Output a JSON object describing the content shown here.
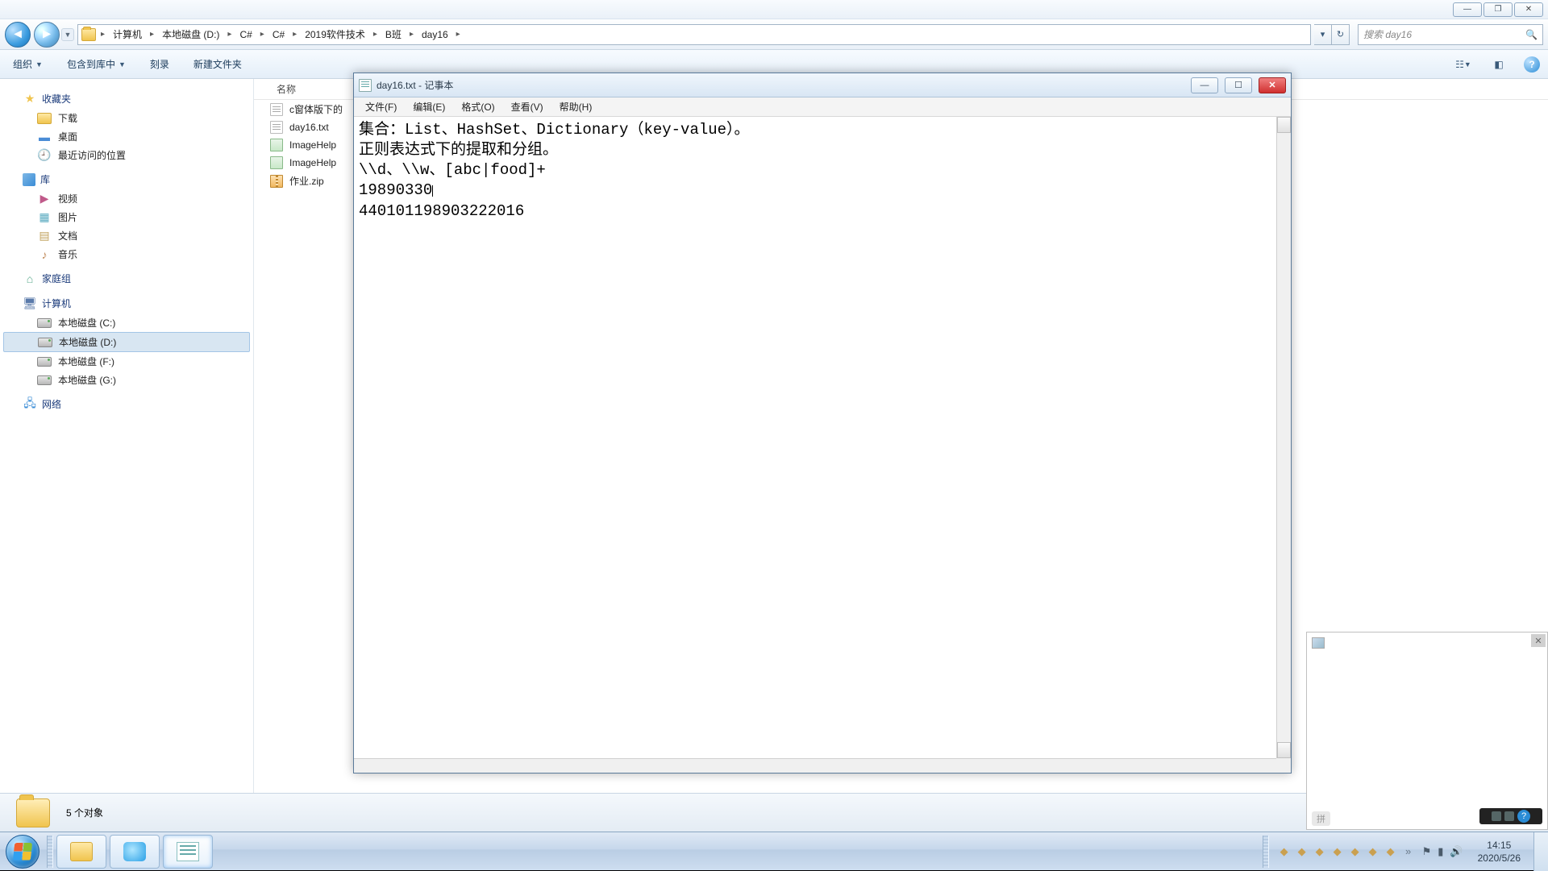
{
  "explorer": {
    "breadcrumbs": [
      "计算机",
      "本地磁盘 (D:)",
      "C#",
      "C#",
      "2019软件技术",
      "B班",
      "day16"
    ],
    "search_placeholder": "搜索 day16",
    "toolbar": {
      "organize": "组织",
      "include": "包含到库中",
      "burn": "刻录",
      "newfolder": "新建文件夹"
    },
    "sidebar": {
      "favorites": {
        "label": "收藏夹",
        "items": [
          "下载",
          "桌面",
          "最近访问的位置"
        ]
      },
      "libraries": {
        "label": "库",
        "items": [
          "视频",
          "图片",
          "文档",
          "音乐"
        ]
      },
      "homegroup": {
        "label": "家庭组"
      },
      "computer": {
        "label": "计算机",
        "items": [
          "本地磁盘 (C:)",
          "本地磁盘 (D:)",
          "本地磁盘 (F:)",
          "本地磁盘 (G:)"
        ]
      },
      "network": {
        "label": "网络"
      }
    },
    "filelist": {
      "header": "名称",
      "items": [
        {
          "name": "c窗体版下的",
          "type": "txt"
        },
        {
          "name": "day16.txt",
          "type": "txt"
        },
        {
          "name": "ImageHelp",
          "type": "cs"
        },
        {
          "name": "ImageHelp",
          "type": "cs"
        },
        {
          "name": "作业.zip",
          "type": "zip"
        }
      ]
    },
    "status": "5 个对象"
  },
  "notepad": {
    "title": "day16.txt - 记事本",
    "menu": [
      "文件(F)",
      "编辑(E)",
      "格式(O)",
      "查看(V)",
      "帮助(H)"
    ],
    "lines": [
      "集合：List、HashSet、Dictionary（key-value）。",
      "正则表达式下的提取和分组。",
      "\\\\d、\\\\w、[abc|food]+",
      "19890330",
      "440101198903222016"
    ]
  },
  "taskbar": {
    "time": "14:15",
    "date": "2020/5/26"
  }
}
